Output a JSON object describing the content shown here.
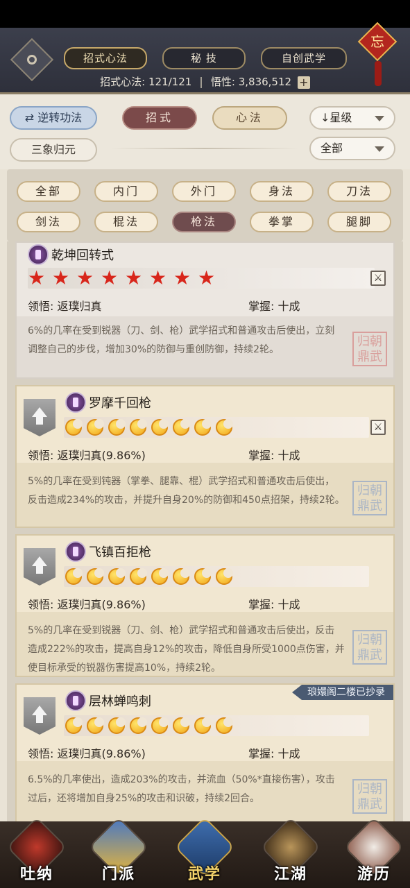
{
  "header": {
    "tabs": [
      {
        "label": "招式心法",
        "active": true
      },
      {
        "label": "秘 技",
        "active": false
      },
      {
        "label": "自创武学",
        "active": false
      }
    ],
    "knot_char": "忘",
    "stat_label": "招式心法:",
    "stat_value": "121/121",
    "wuxing_label": "悟性:",
    "wuxing_value": "3,836,512",
    "plus": "+"
  },
  "controls": {
    "reverse_label": "逆转功法",
    "reverse_icon": "⇄",
    "zhaoshi_label": "招式",
    "xinfa_label": "心法",
    "sanxiang_label": "三象归元",
    "sort_label": "↓星级",
    "filter_label": "全部"
  },
  "categories": [
    {
      "label": "全部",
      "active": false
    },
    {
      "label": "内门",
      "active": false
    },
    {
      "label": "外门",
      "active": false
    },
    {
      "label": "身法",
      "active": false
    },
    {
      "label": "刀法",
      "active": false
    },
    {
      "label": "剑法",
      "active": false
    },
    {
      "label": "棍法",
      "active": false
    },
    {
      "label": "枪法",
      "active": true
    },
    {
      "label": "拳掌",
      "active": false
    },
    {
      "label": "腿脚",
      "active": false
    }
  ],
  "cards": [
    {
      "title": "乾坤回转式",
      "rating_type": "star",
      "rating_count": 8,
      "lingwu_label": "领悟:",
      "lingwu_value": "返璞归真",
      "zhangwo_label": "掌握:",
      "zhangwo_value": "十成",
      "desc1": "6%的几率在受到锐器（刀、剑、枪）武学招式和普通攻击后使出，立刻",
      "desc2": "调整自己的步伐，增加30%的防御与重创防御，持续2轮。",
      "desc3": "",
      "seal": "归朝鼎武"
    },
    {
      "title": "罗摩千回枪",
      "rating_type": "moon",
      "rating_count": 8,
      "lingwu_label": "领悟:",
      "lingwu_value": "返璞归真(9.86%)",
      "zhangwo_label": "掌握:",
      "zhangwo_value": "十成",
      "desc1": "5%的几率在受到钝器（掌拳、腿靠、棍）武学招式和普通攻击后使出，",
      "desc2": "反击造成234%的攻击，并提升自身20%的防御和450点招架，持续2轮。",
      "desc3": "",
      "seal": "归朝鼎武"
    },
    {
      "title": "飞镇百拒枪",
      "rating_type": "moon",
      "rating_count": 8,
      "lingwu_label": "领悟:",
      "lingwu_value": "返璞归真(9.86%)",
      "zhangwo_label": "掌握:",
      "zhangwo_value": "十成",
      "desc1": "5%的几率在受到锐器（刀、剑、枪）武学招式和普通攻击后使出，反击",
      "desc2": "造成222%的攻击，提高自身12%的攻击，降低自身所受1000点伤害，并",
      "desc3": "使目标承受的锐器伤害提高10%，持续2轮。",
      "seal": "归朝鼎武"
    },
    {
      "title": "层林蝉鸣刺",
      "rating_type": "moon",
      "rating_count": 8,
      "lingwu_label": "领悟:",
      "lingwu_value": "返璞归真(9.86%)",
      "zhangwo_label": "掌握:",
      "zhangwo_value": "十成",
      "ribbon": "琅嬛阁二楼已抄录",
      "desc1": "6.5%的几率使出，造成203%的攻击，并流血（50%*直接伤害），攻击",
      "desc2": "过后，还将增加自身25%的攻击和识破，持续2回合。",
      "desc3": "",
      "seal": "归朝鼎武"
    }
  ],
  "bottom_nav": [
    {
      "label": "吐纳",
      "icon": "meditation-icon",
      "active": false
    },
    {
      "label": "门派",
      "icon": "sect-icon",
      "active": false
    },
    {
      "label": "武学",
      "icon": "martial-book-icon",
      "active": true
    },
    {
      "label": "江湖",
      "icon": "jianghu-icon",
      "active": false
    },
    {
      "label": "游历",
      "icon": "travel-horse-icon",
      "active": false
    }
  ]
}
